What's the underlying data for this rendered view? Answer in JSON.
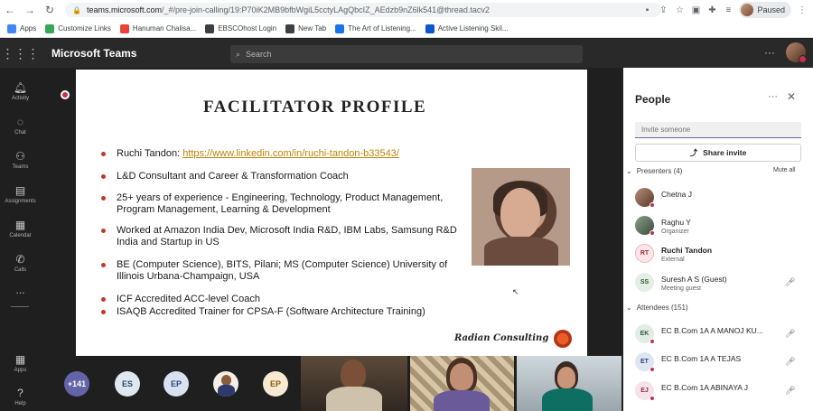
{
  "browser": {
    "url_host": "teams.microsoft.com",
    "url_path": "/_#/pre-join-calling/19:P70iK2MB9bfbWgiL5cctyLAgQbcIZ_AEdzb9nZ6lk541@thread.tacv2",
    "profile_status": "Paused",
    "bookmarks": [
      "Apps",
      "Customize Links",
      "Hanuman Chalisa...",
      "EBSCOhost Login",
      "New Tab",
      "The Art of Listening...",
      "Active Listening Skil..."
    ]
  },
  "teams": {
    "app_title": "Microsoft Teams",
    "search_placeholder": "Search"
  },
  "rail": {
    "items": [
      {
        "label": "Activity",
        "icon": "bell-icon"
      },
      {
        "label": "Chat",
        "icon": "chat-icon"
      },
      {
        "label": "Teams",
        "icon": "teams-icon"
      },
      {
        "label": "Assignments",
        "icon": "assignments-icon"
      },
      {
        "label": "Calendar",
        "icon": "calendar-icon"
      },
      {
        "label": "Calls",
        "icon": "phone-icon"
      }
    ],
    "more": "...",
    "apps_label": "Apps",
    "help_label": "Help"
  },
  "slide": {
    "title": "FACILITATOR PROFILE",
    "bullets": [
      {
        "prefix": "Ruchi Tandon: ",
        "link": "https://www.linkedin.com/in/ruchi-tandon-b33543/"
      },
      {
        "line1": "L&D Consultant and Career & Transformation Coach"
      },
      {
        "line1": "25+ years of experience - Engineering, Technology, Product Management,",
        "line2": "Program Management, Learning & Development"
      },
      {
        "line1": "Worked at Amazon India Dev, Microsoft India R&D, IBM Labs, Samsung R&D",
        "line2": "India and Startup in US"
      },
      {
        "line1": "BE (Computer Science), BITS, Pilani; MS (Computer Science) University of",
        "line2": "Illinois Urbana-Champaign, USA"
      },
      {
        "line1": "ICF Accredited ACC-level Coach"
      },
      {
        "line1": "ISAQB Accredited Trainer for CPSA-F (Software Architecture Training)"
      }
    ],
    "brand": "Radian Consulting"
  },
  "video_strip": {
    "overflow_count": "+141",
    "avatars": [
      "ES",
      "EP",
      "EP"
    ]
  },
  "people": {
    "title": "People",
    "invite_placeholder": "Invite someone",
    "share_invite": "Share invite",
    "presenters_label": "Presenters (4)",
    "mute_all": "Mute all",
    "presenters": [
      {
        "name": "Chetna J",
        "role": "",
        "initials": ""
      },
      {
        "name": "Raghu Y",
        "role": "Organizer",
        "initials": ""
      },
      {
        "name": "Ruchi Tandon",
        "role": "External",
        "initials": "RT"
      },
      {
        "name": "Suresh A S (Guest)",
        "role": "Meeting guest",
        "initials": "SS"
      }
    ],
    "attendees_label": "Attendees (151)",
    "attendees": [
      {
        "name": "EC B.Com 1A A MANOJ KU...",
        "initials": "EK"
      },
      {
        "name": "EC B.Com 1A A TEJAS",
        "initials": "ET"
      },
      {
        "name": "EC B.Com 1A ABINAYA J",
        "initials": "EJ"
      }
    ]
  }
}
